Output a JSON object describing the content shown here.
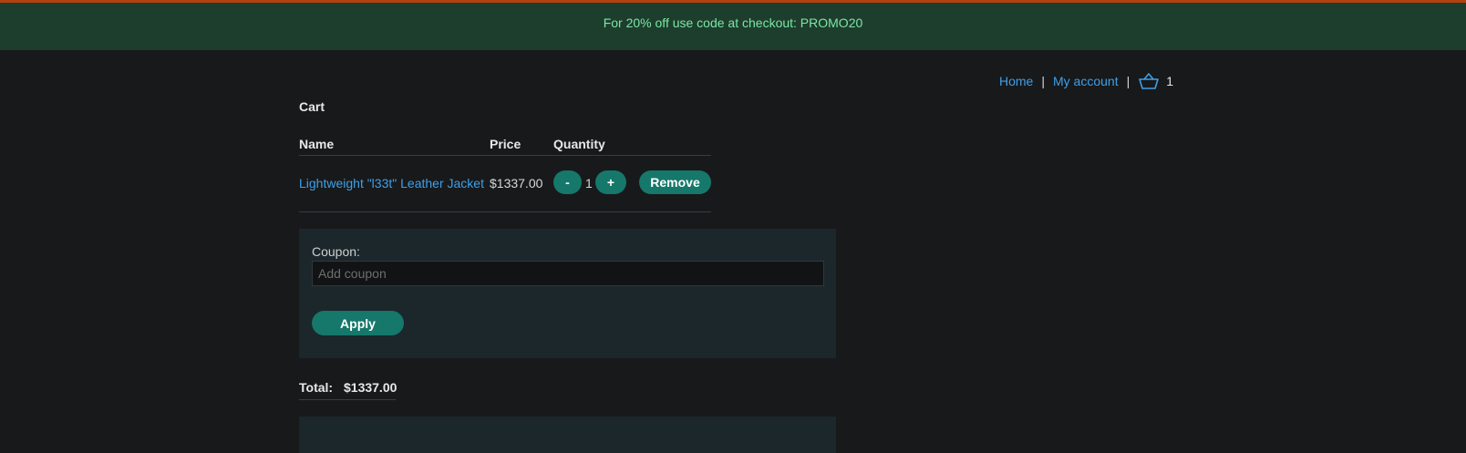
{
  "banner": {
    "text": "For 20% off use code at checkout: PROMO20"
  },
  "nav": {
    "home": "Home",
    "separator": "|",
    "my_account": "My account",
    "cart_count": "1",
    "cart_icon": "basket-icon"
  },
  "cart": {
    "title": "Cart",
    "columns": {
      "name": "Name",
      "price": "Price",
      "quantity": "Quantity"
    },
    "items": [
      {
        "name": "Lightweight \"l33t\" Leather Jacket",
        "price": "$1337.00",
        "quantity": "1",
        "minus_label": "-",
        "plus_label": "+",
        "remove_label": "Remove"
      }
    ]
  },
  "coupon": {
    "label": "Coupon:",
    "placeholder": "Add coupon",
    "value": "",
    "apply_label": "Apply"
  },
  "total": {
    "label": "Total:",
    "value": "$1337.00"
  },
  "colors": {
    "accent": "#15786a",
    "link": "#3ea0e8",
    "banner_bg": "#1d3e2d",
    "banner_text": "#7de6a6",
    "top_stripe": "#b3410e",
    "background": "#18191b",
    "panel": "#1b272b"
  }
}
